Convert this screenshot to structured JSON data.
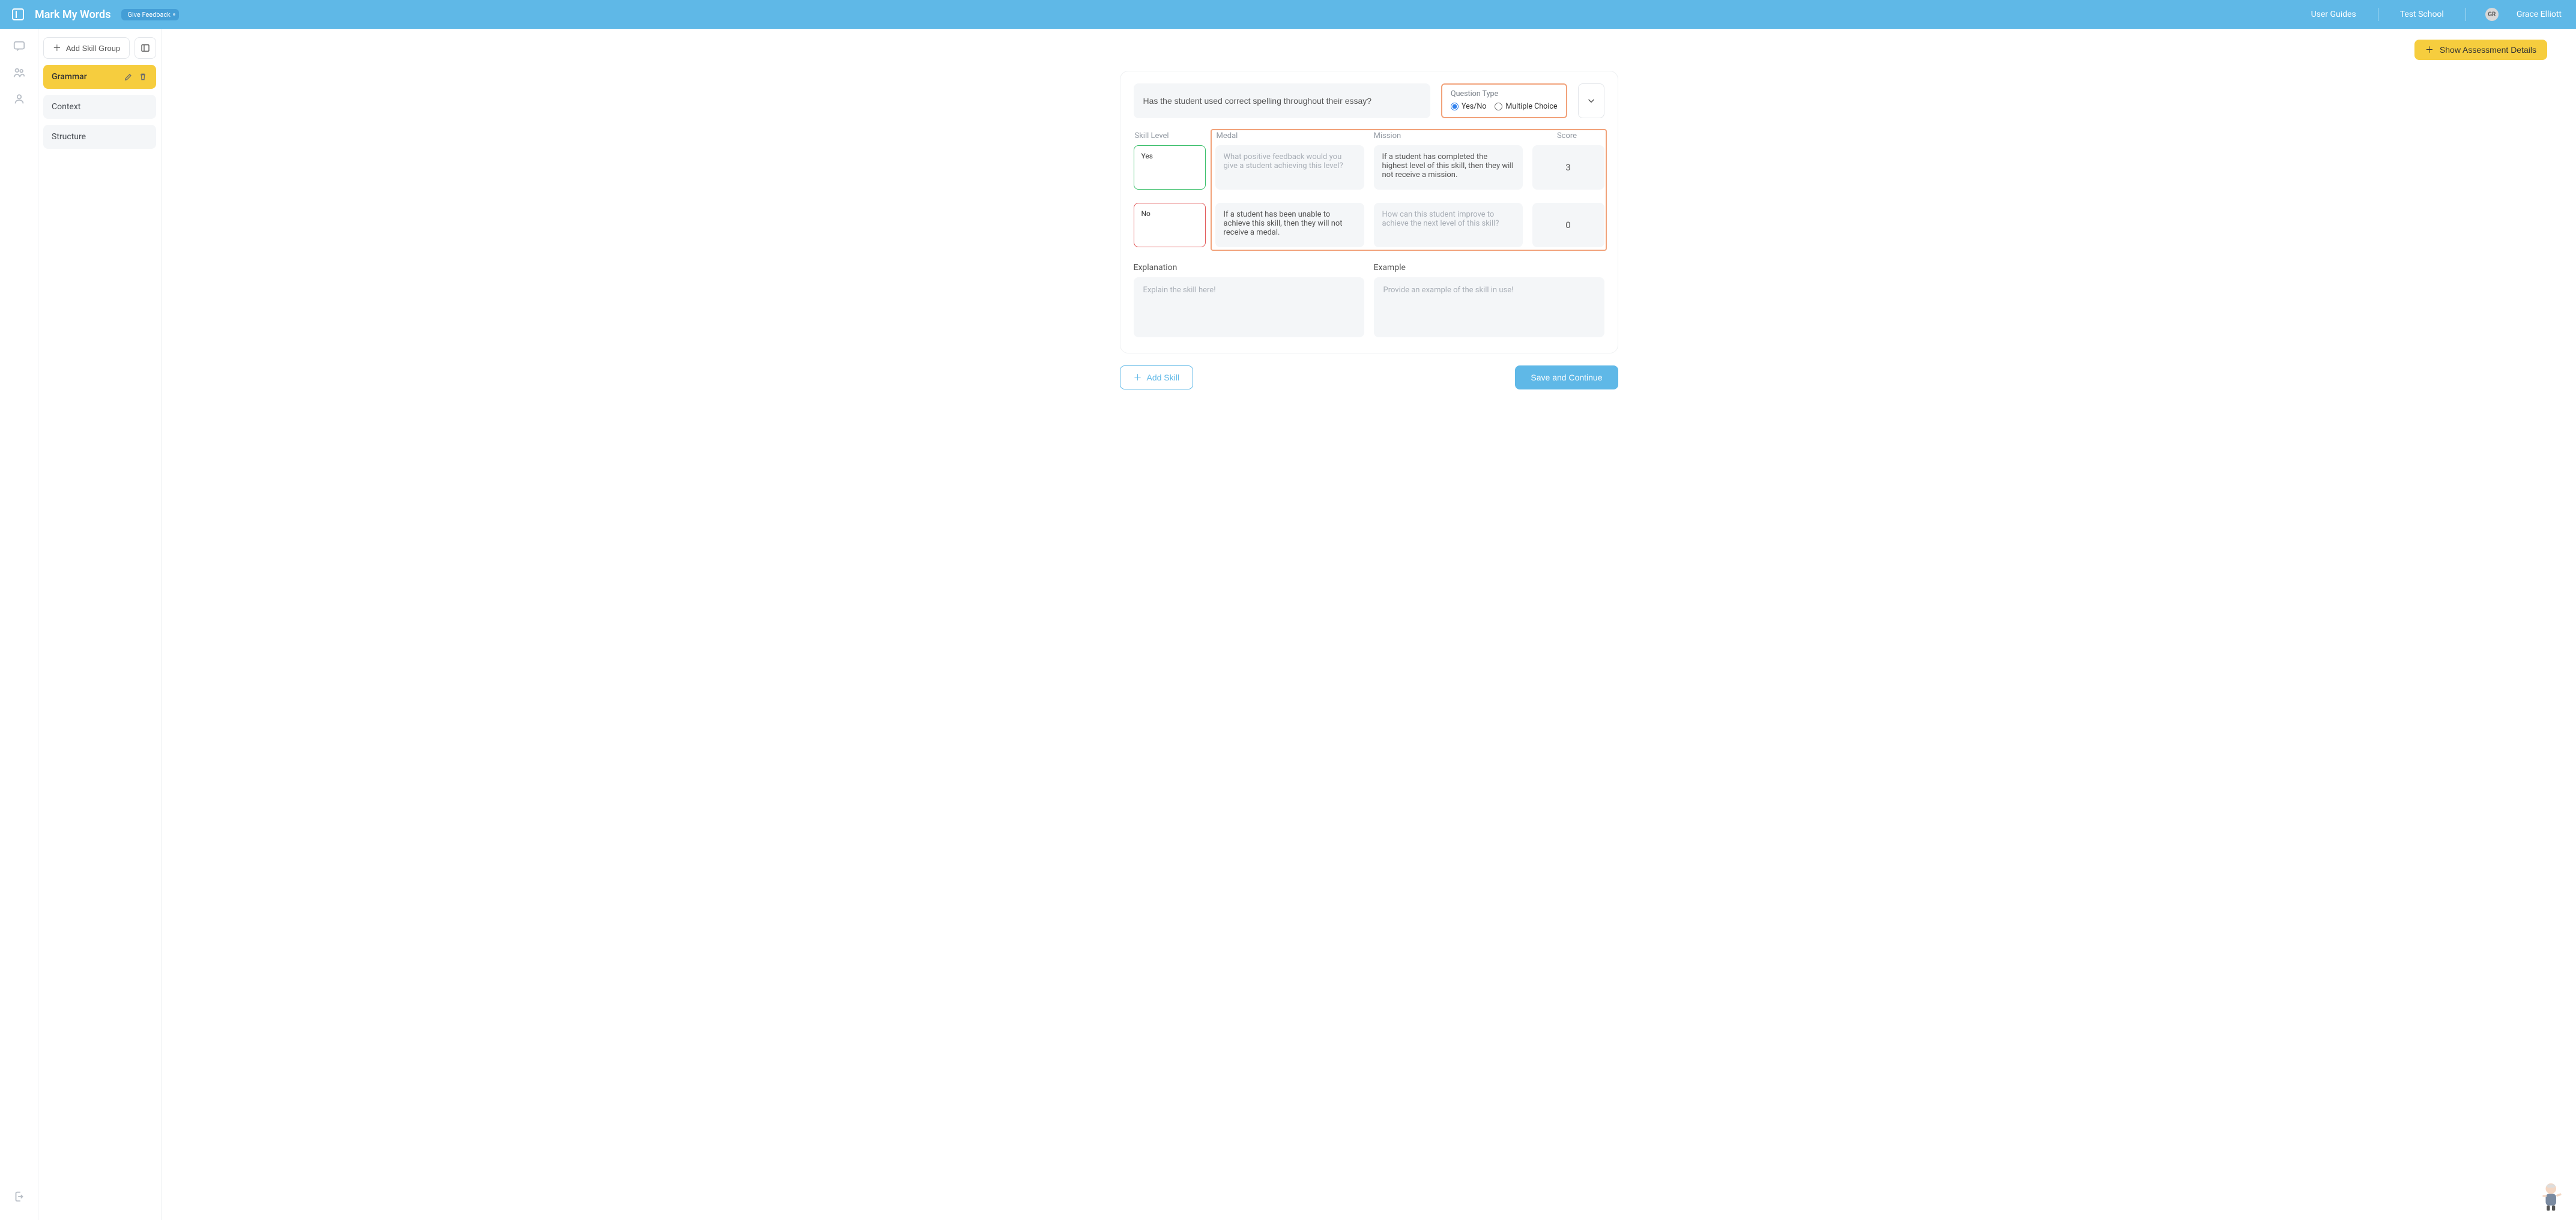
{
  "header": {
    "brand": "Mark My Words",
    "feedback": "Give Feedback",
    "user_guides": "User Guides",
    "school": "Test School",
    "avatar_initials": "GR",
    "user_name": "Grace Elliott"
  },
  "panel": {
    "add_group_label": "Add Skill Group",
    "groups": [
      {
        "label": "Grammar",
        "active": true
      },
      {
        "label": "Context",
        "active": false
      },
      {
        "label": "Structure",
        "active": false
      }
    ]
  },
  "toolbar": {
    "show_assessment": "Show Assessment Details"
  },
  "question": {
    "text": "Has the student used correct spelling throughout their essay?",
    "type_title": "Question Type",
    "opt_yesno": "Yes/No",
    "opt_mc": "Multiple Choice",
    "selected": "yesno"
  },
  "columns": {
    "skill_level": "Skill Level",
    "medal": "Medal",
    "mission": "Mission",
    "score": "Score"
  },
  "rows": [
    {
      "level": "Yes",
      "level_kind": "yes",
      "medal_placeholder": "What positive feedback would you give a student achieving this level?",
      "medal_value": "",
      "mission_value": "If a student has completed the highest level of this skill, then they will not receive a mission.",
      "mission_placeholder": "",
      "score": "3"
    },
    {
      "level": "No",
      "level_kind": "no",
      "medal_value": "If a student has been unable to achieve this skill, then they will not receive a medal.",
      "medal_placeholder": "",
      "mission_placeholder": "How can this student improve to achieve the next level of this skill?",
      "mission_value": "",
      "score": "0"
    }
  ],
  "sections": {
    "explanation_label": "Explanation",
    "example_label": "Example",
    "explanation_placeholder": "Explain the skill here!",
    "example_placeholder": "Provide an example of the skill in use!"
  },
  "footer": {
    "add_skill": "Add Skill",
    "save": "Save and Continue"
  },
  "colors": {
    "primary": "#5fb8e7",
    "accent": "#f6cd3e",
    "highlight_border": "#f1a27a",
    "green": "#3bbf6b",
    "red": "#e25b5b"
  }
}
